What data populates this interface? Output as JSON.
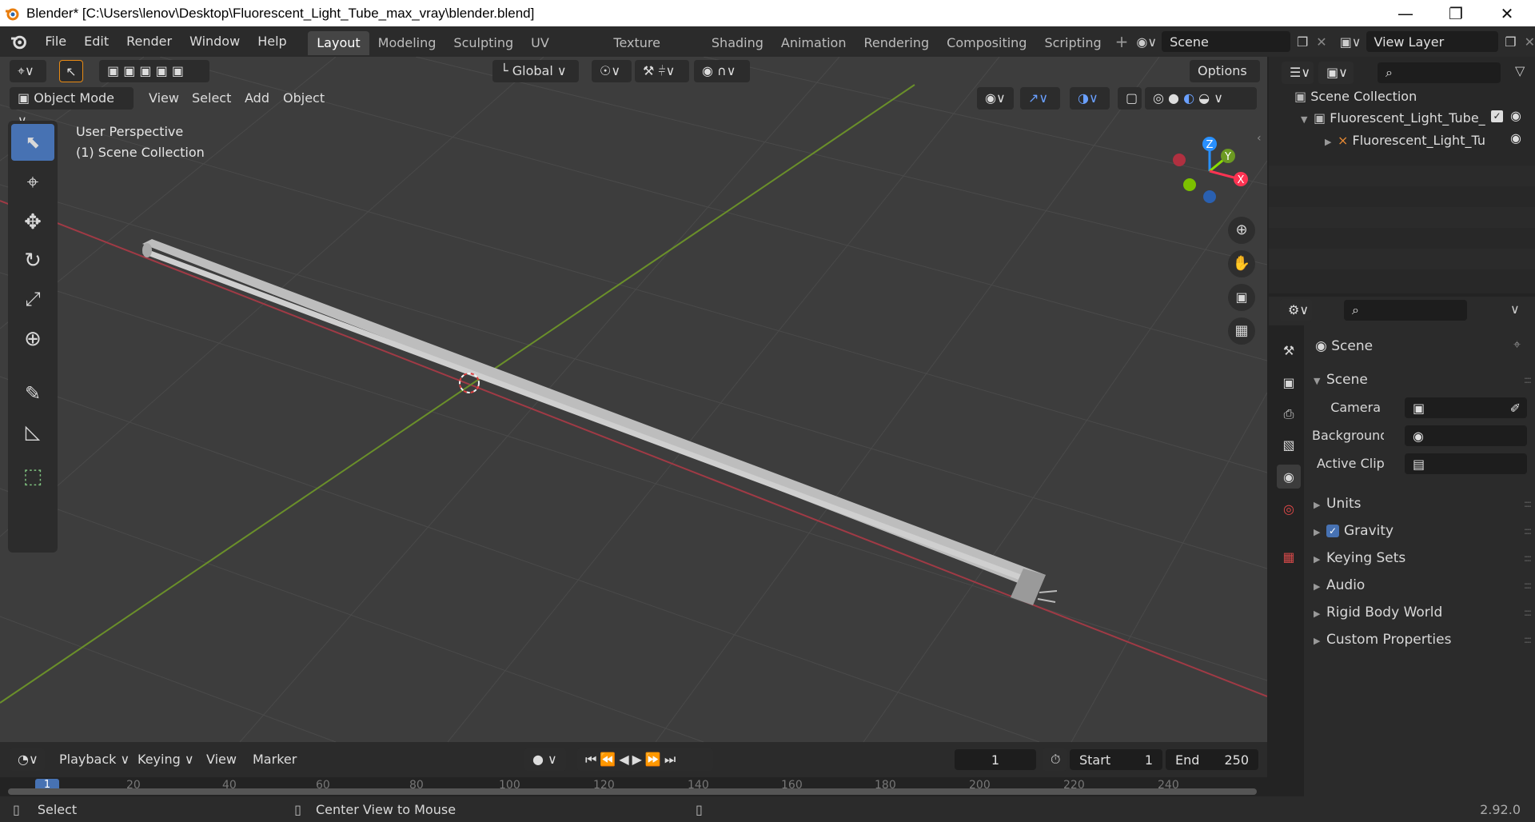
{
  "window": {
    "title": "Blender* [C:\\Users\\lenov\\Desktop\\Fluorescent_Light_Tube_max_vray\\blender.blend]"
  },
  "menu": [
    "File",
    "Edit",
    "Render",
    "Window",
    "Help"
  ],
  "workspaces": [
    "Layout",
    "Modeling",
    "Sculpting",
    "UV Editing",
    "Texture Paint",
    "Shading",
    "Animation",
    "Rendering",
    "Compositing",
    "Scripting"
  ],
  "scene_field": "Scene",
  "view_layer_field": "View Layer",
  "viewport": {
    "orientation": "Global",
    "options_label": "Options",
    "mode": "Object Mode",
    "header_menus": [
      "View",
      "Select",
      "Add",
      "Object"
    ],
    "overlay_line1": "User Perspective",
    "overlay_line2": "(1) Scene Collection",
    "gizmo_axes": {
      "x": "X",
      "y": "Y",
      "z": "Z"
    }
  },
  "outliner": {
    "root": "Scene Collection",
    "collection": "Fluorescent_Light_Tube_",
    "object": "Fluorescent_Light_Tu"
  },
  "properties": {
    "context": "Scene",
    "panel": "Scene",
    "camera_label": "Camera",
    "background_label": "Background ...",
    "active_clip_label": "Active Clip",
    "sections": [
      "Units",
      "Gravity",
      "Keying Sets",
      "Audio",
      "Rigid Body World",
      "Custom Properties"
    ],
    "gravity_enabled": true
  },
  "timeline": {
    "menus": [
      "Playback",
      "Keying",
      "View",
      "Marker"
    ],
    "current_frame": "1",
    "start_label": "Start",
    "start_value": "1",
    "end_label": "End",
    "end_value": "250",
    "ruler_ticks": [
      "1",
      "20",
      "40",
      "60",
      "80",
      "100",
      "120",
      "140",
      "160",
      "180",
      "200",
      "220",
      "240"
    ]
  },
  "status": {
    "left": "Select",
    "middle": "Center View to Mouse",
    "version": "2.92.0"
  },
  "colors": {
    "accent": "#4772b3",
    "x_axis": "#ff3352",
    "y_axis": "#8bdc00",
    "z_axis": "#2890ff"
  }
}
